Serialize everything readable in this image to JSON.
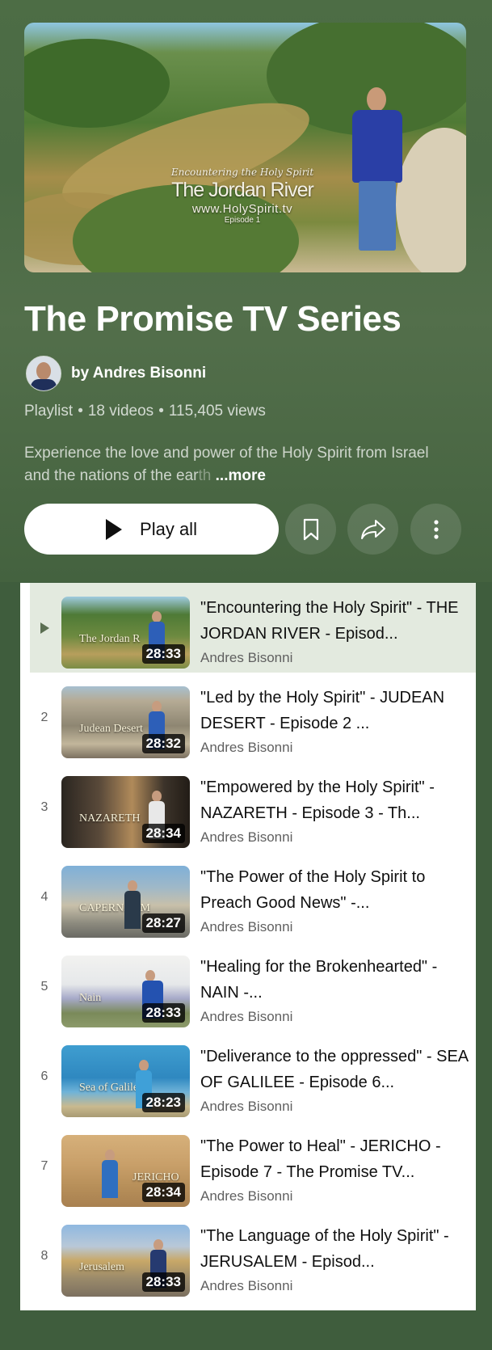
{
  "playlist": {
    "thumbnail_text": {
      "line1": "Encountering the Holy Spirit",
      "line2": "The Jordan River",
      "line3": "www.HolySpirit.tv",
      "line4": "Episode 1"
    },
    "title": "The Promise TV Series",
    "author": "by Andres Bisonni",
    "meta": {
      "type": "Playlist",
      "videos": "18 videos",
      "views": "115,405 views",
      "separator": "•"
    },
    "description_visible": "Experience the love and power of the Holy Spirit from Israel and the nations of the ear",
    "description_faded": "th",
    "more_label": "...more",
    "play_all_label": "Play all",
    "actions": [
      "bookmark-icon",
      "share-icon",
      "more-vert-icon"
    ]
  },
  "colors": {
    "header_bg": "#4a6a44",
    "active_row_bg": "#e3eadf",
    "list_bg": "#ffffff"
  },
  "videos": [
    {
      "index": "",
      "active": true,
      "title": "\"Encountering the Holy Spirit\" - THE JORDAN RIVER - Episod...",
      "channel": "Andres Bisonni",
      "duration": "28:33",
      "thumb_label": "The Jordan R"
    },
    {
      "index": "2",
      "active": false,
      "title": "\"Led by the Holy Spirit\" - JUDEAN DESERT - Episode 2 ...",
      "channel": "Andres Bisonni",
      "duration": "28:32",
      "thumb_label": "Judean Desert"
    },
    {
      "index": "3",
      "active": false,
      "title": "\"Empowered by the Holy Spirit\" - NAZARETH - Episode 3 - Th...",
      "channel": "Andres Bisonni",
      "duration": "28:34",
      "thumb_label": "NAZARETH"
    },
    {
      "index": "4",
      "active": false,
      "title": "\"The Power of the Holy Spirit to Preach Good News\" -...",
      "channel": "Andres Bisonni",
      "duration": "28:27",
      "thumb_label": "CAPERNAUM"
    },
    {
      "index": "5",
      "active": false,
      "title": "\"Healing for the Brokenhearted\" - NAIN -...",
      "channel": "Andres Bisonni",
      "duration": "28:33",
      "thumb_label": "Nain"
    },
    {
      "index": "6",
      "active": false,
      "title": "\"Deliverance to the oppressed\" - SEA OF GALILEE - Episode 6...",
      "channel": "Andres Bisonni",
      "duration": "28:23",
      "thumb_label": "Sea of Galilee"
    },
    {
      "index": "7",
      "active": false,
      "title": "\"The Power to Heal\" - JERICHO - Episode 7 - The Promise TV...",
      "channel": "Andres Bisonni",
      "duration": "28:34",
      "thumb_label": "JERICHO"
    },
    {
      "index": "8",
      "active": false,
      "title": "\"The Language of the Holy Spirit\" - JERUSALEM - Episod...",
      "channel": "Andres Bisonni",
      "duration": "28:33",
      "thumb_label": "Jerusalem"
    }
  ]
}
